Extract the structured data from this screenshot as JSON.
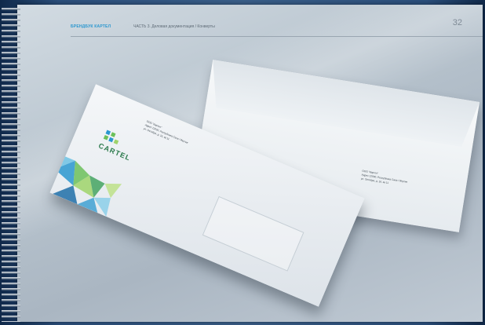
{
  "header": {
    "brand": "БРЕНДБУК КАРТЕЛ",
    "section": "ЧАСТЬ 3. Деловая документация / Конверты",
    "page_number": "32"
  },
  "envelope_front": {
    "address_lines": [
      "ООО \"Картел\"",
      "Адрес 12000, Республика Саха / Якутия",
      "ул. Октября, д. 16, кв 11"
    ],
    "logo_text": "CARTEL"
  },
  "envelope_back": {
    "address_lines": [
      "ООО \"Картел\"",
      "Адрес 12000, Республика Саха / Якутия",
      "ул. Октября, д. 16, кв 11"
    ]
  },
  "colors": {
    "accent": "#2a97cf",
    "logo_green": "#2b7a4c",
    "logo_blue": "#2a97cf"
  }
}
